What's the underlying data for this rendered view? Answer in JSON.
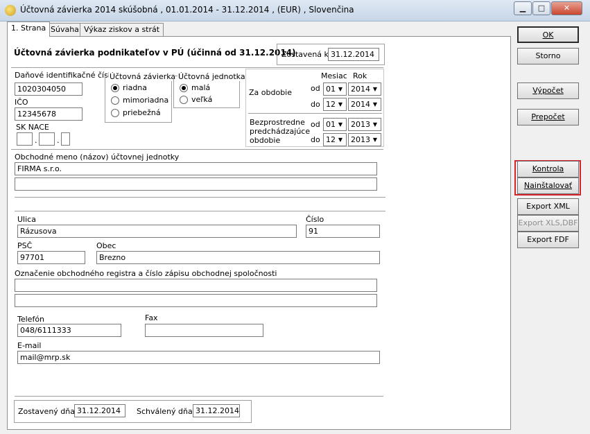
{
  "window": {
    "title": "Účtovná závierka 2014 skúšobná ,  01.01.2014 - 31.12.2014 ,  (EUR) ,  Slovenčina",
    "min_label": "▁",
    "max_label": "□",
    "close_label": "✕"
  },
  "tabs": [
    "1. Strana",
    "Súvaha",
    "Výkaz ziskov a strát"
  ],
  "form": {
    "heading": "Účtovná závierka podnikateľov v PÚ (účinná od 31.12.2014)",
    "zostavena_label": "Zostavená k",
    "zostavena_value": "31.12.2014",
    "dic_label": "Daňové identifikačné číslo",
    "dic_value": "1020304050",
    "ico_label": "IČO",
    "ico_value": "12345678",
    "sknace_label": "SK NACE",
    "sknace_dot1": ".",
    "sknace_dot2": ".",
    "zavierka_label": "Účtovná závierka",
    "zavierka_options": [
      "riadna",
      "mimoriadna",
      "priebežná"
    ],
    "jednotka_label": "Účtovná jednotka",
    "jednotka_options": [
      "malá",
      "veľká"
    ],
    "mesiac_label": "Mesiac",
    "rok_label": "Rok",
    "za_obdobie_label": "Za obdobie",
    "od_label": "od",
    "do_label": "do",
    "za_od_mesiac": "01",
    "za_od_rok": "2014",
    "za_do_mesiac": "12",
    "za_do_rok": "2014",
    "bezp_label_1": "Bezprostredne",
    "bezp_label_2": "predchádzajúce",
    "bezp_label_3": "obdobie",
    "bp_od_mesiac": "01",
    "bp_od_rok": "2013",
    "bp_do_mesiac": "12",
    "bp_do_rok": "2013",
    "obch_meno_label": "Obchodné meno (názov) účtovnej jednotky",
    "obch_meno_1": "FIRMA s.r.o.",
    "obch_meno_2": "",
    "ulica_label": "Ulica",
    "ulica_value": "Rázusova",
    "cislo_label": "Číslo",
    "cislo_value": "91",
    "psc_label": "PSČ",
    "psc_value": "97701",
    "obec_label": "Obec",
    "obec_value": "Brezno",
    "register_label": "Označenie obchodného registra a číslo zápisu obchodnej spoločnosti",
    "register_1": "",
    "register_2": "",
    "telefon_label": "Telefón",
    "telefon_value": "048/6111333",
    "fax_label": "Fax",
    "fax_value": "",
    "email_label": "E-mail",
    "email_value": "mail@mrp.sk",
    "zostaveny_dna_label": "Zostavený dňa:",
    "zostaveny_dna_value": "31.12.2014",
    "schvaleny_dna_label": "Schválený dňa:",
    "schvaleny_dna_value": "31.12.2014"
  },
  "buttons": {
    "ok": "OK",
    "storno": "Storno",
    "vypocet": "Výpočet",
    "prepocet": "Prepočet",
    "kontrola": "Kontrola",
    "nainstalovat": "Nainštalovať",
    "export_xml": "Export XML",
    "export_xls": "Export XLS,DBF",
    "export_fdf": "Export FDF"
  },
  "colors": {
    "highlight": "#d6242c"
  }
}
